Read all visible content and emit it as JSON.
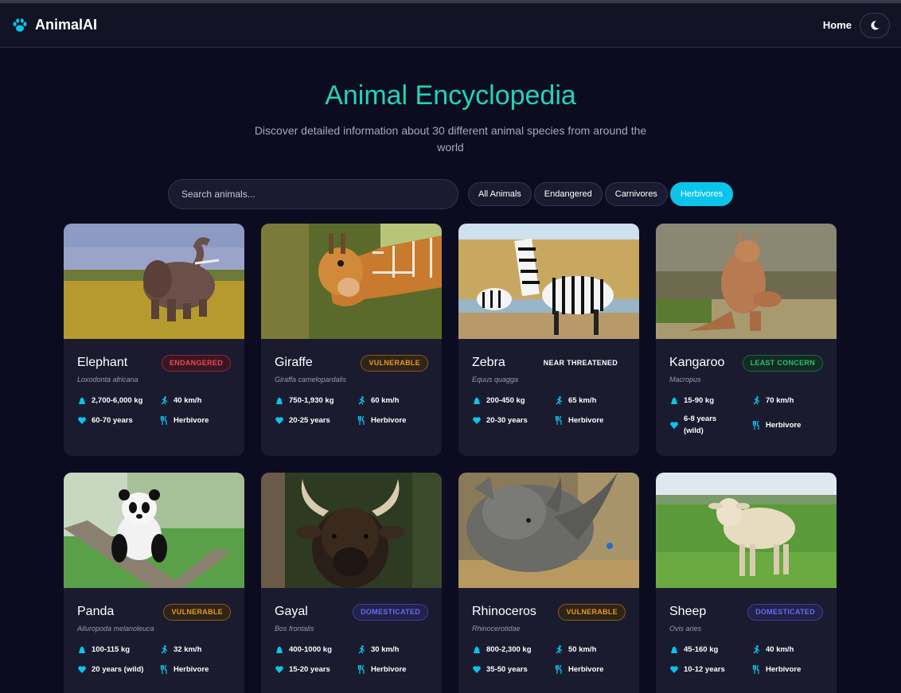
{
  "brand": {
    "name": "AnimalAI",
    "icon": "paw-icon",
    "color": "#0bc4ea"
  },
  "nav": {
    "home_label": "Home",
    "theme_icon": "moon-icon"
  },
  "hero": {
    "title": "Animal Encyclopedia",
    "subtitle": "Discover detailed information about 30 different animal species from around the world"
  },
  "search": {
    "placeholder": "Search animals...",
    "value": ""
  },
  "filters": [
    {
      "label": "All Animals",
      "active": false
    },
    {
      "label": "Endangered",
      "active": false
    },
    {
      "label": "Carnivores",
      "active": false
    },
    {
      "label": "Herbivores",
      "active": true
    }
  ],
  "colors": {
    "accent": "#0bc4ea",
    "title": "#22d3b8",
    "background": "#0c0c20",
    "card": "#1b1b30"
  },
  "animals": [
    {
      "name": "Elephant",
      "scientific": "Loxodonta africana",
      "status": "ENDANGERED",
      "status_class": "endangered",
      "weight": "2,700-6,000 kg",
      "speed": "40 km/h",
      "lifespan": "60-70 years",
      "diet": "Herbivore",
      "image": "elephant"
    },
    {
      "name": "Giraffe",
      "scientific": "Giraffa camelopardalis",
      "status": "VULNERABLE",
      "status_class": "vulnerable",
      "weight": "750-1,930 kg",
      "speed": "60 km/h",
      "lifespan": "20-25 years",
      "diet": "Herbivore",
      "image": "giraffe"
    },
    {
      "name": "Zebra",
      "scientific": "Equus quagga",
      "status": "NEAR THREATENED",
      "status_class": "near",
      "weight": "200-450 kg",
      "speed": "65 km/h",
      "lifespan": "20-30 years",
      "diet": "Herbivore",
      "image": "zebra"
    },
    {
      "name": "Kangaroo",
      "scientific": "Macropus",
      "status": "LEAST CONCERN",
      "status_class": "least",
      "weight": "15-90 kg",
      "speed": "70 km/h",
      "lifespan": "6-8 years (wild)",
      "diet": "Herbivore",
      "image": "kangaroo"
    },
    {
      "name": "Panda",
      "scientific": "Ailuropoda melanoleuca",
      "status": "VULNERABLE",
      "status_class": "vulnerable",
      "weight": "100-115 kg",
      "speed": "32 km/h",
      "lifespan": "20 years (wild)",
      "diet": "Herbivore",
      "image": "panda"
    },
    {
      "name": "Gayal",
      "scientific": "Bos frontalis",
      "status": "DOMESTICATED",
      "status_class": "domesticated",
      "weight": "400-1000 kg",
      "speed": "30 km/h",
      "lifespan": "15-20 years",
      "diet": "Herbivore",
      "image": "gayal"
    },
    {
      "name": "Rhinoceros",
      "scientific": "Rhinocerotidae",
      "status": "VULNERABLE",
      "status_class": "vulnerable",
      "weight": "800-2,300 kg",
      "speed": "50 km/h",
      "lifespan": "35-50 years",
      "diet": "Herbivore",
      "image": "rhinoceros"
    },
    {
      "name": "Sheep",
      "scientific": "Ovis aries",
      "status": "DOMESTICATED",
      "status_class": "domesticated",
      "weight": "45-160 kg",
      "speed": "40 km/h",
      "lifespan": "10-12 years",
      "diet": "Herbivore",
      "image": "sheep"
    }
  ]
}
